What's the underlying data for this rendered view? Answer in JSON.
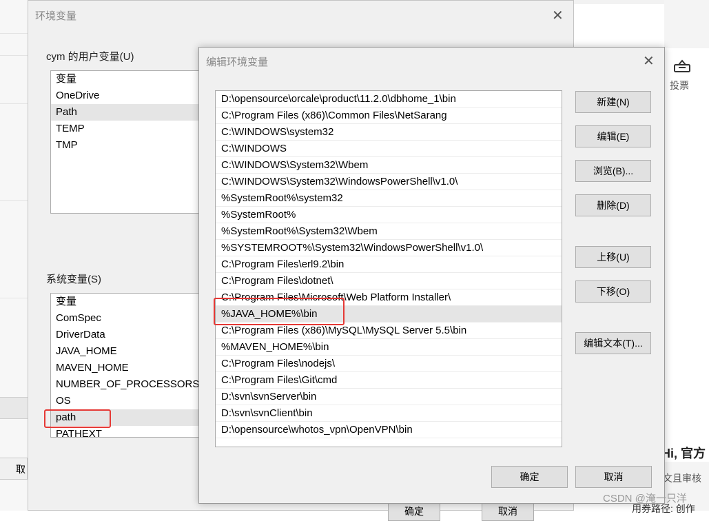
{
  "background": {
    "vote_label": "投票",
    "hi_text": "Hi, 官方",
    "review_text": "文且审核",
    "watermark": "CSDN @淹一只洋",
    "bottom_path": "用券路径: 创作",
    "left_cancel": "取"
  },
  "env_dialog": {
    "title": "环境变量",
    "close": "✕",
    "user_group_label": "cym 的用户变量(U)",
    "user_vars": [
      "变量",
      "OneDrive",
      "Path",
      "TEMP",
      "TMP"
    ],
    "system_group_label": "系统变量(S)",
    "system_vars": [
      "变量",
      "ComSpec",
      "DriverData",
      "JAVA_HOME",
      "MAVEN_HOME",
      "NUMBER_OF_PROCESSORS",
      "OS",
      "path",
      "PATHEXT"
    ],
    "ok_label": "确定",
    "cancel_label": "取消"
  },
  "edit_dialog": {
    "title": "编辑环境变量",
    "close": "✕",
    "paths": [
      "D:\\opensource\\orcale\\product\\11.2.0\\dbhome_1\\bin",
      "C:\\Program Files (x86)\\Common Files\\NetSarang",
      "C:\\WINDOWS\\system32",
      "C:\\WINDOWS",
      "C:\\WINDOWS\\System32\\Wbem",
      "C:\\WINDOWS\\System32\\WindowsPowerShell\\v1.0\\",
      "%SystemRoot%\\system32",
      "%SystemRoot%",
      "%SystemRoot%\\System32\\Wbem",
      "%SYSTEMROOT%\\System32\\WindowsPowerShell\\v1.0\\",
      "C:\\Program Files\\erl9.2\\bin",
      "C:\\Program Files\\dotnet\\",
      "C:\\Program Files\\Microsoft\\Web Platform Installer\\",
      "%JAVA_HOME%\\bin",
      "C:\\Program Files (x86)\\MySQL\\MySQL Server 5.5\\bin",
      "%MAVEN_HOME%\\bin",
      "C:\\Program Files\\nodejs\\",
      "C:\\Program Files\\Git\\cmd",
      "D:\\svn\\svnServer\\bin",
      "D:\\svn\\svnClient\\bin",
      "D:\\opensource\\whotos_vpn\\OpenVPN\\bin"
    ],
    "buttons": {
      "new": "新建(N)",
      "edit": "编辑(E)",
      "browse": "浏览(B)...",
      "delete": "删除(D)",
      "move_up": "上移(U)",
      "move_down": "下移(O)",
      "edit_text": "编辑文本(T)..."
    },
    "ok_label": "确定",
    "cancel_label": "取消"
  }
}
